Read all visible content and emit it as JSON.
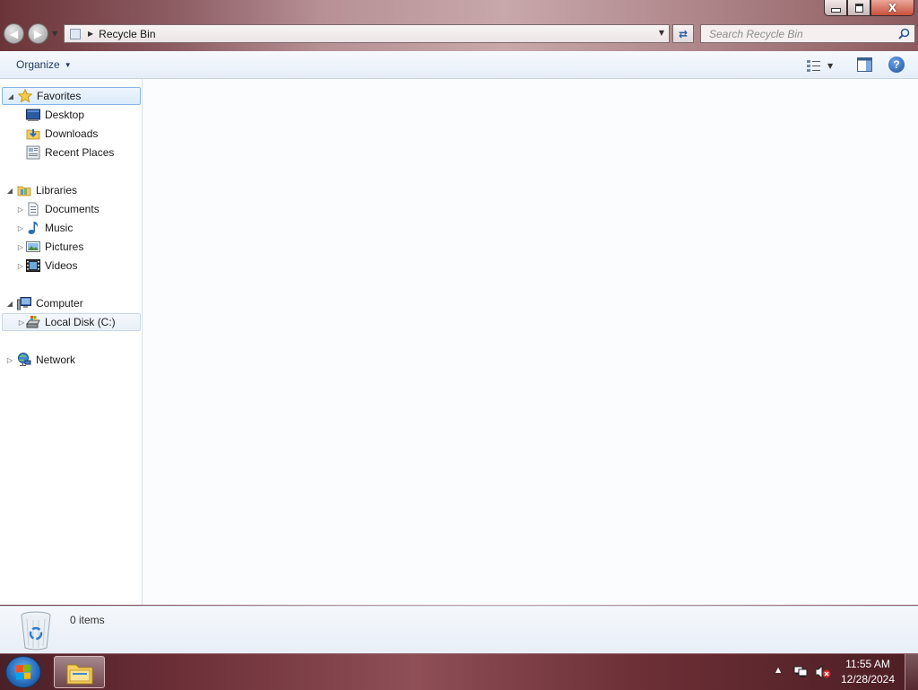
{
  "window": {
    "caption": {
      "minimize": "",
      "maximize": "",
      "close": "X"
    }
  },
  "nav": {
    "breadcrumb": "Recycle Bin",
    "search_placeholder": "Search Recycle Bin"
  },
  "toolbar": {
    "organize_label": "Organize",
    "help_label": "?"
  },
  "sidebar": {
    "favorites": {
      "label": "Favorites",
      "items": [
        {
          "label": "Desktop"
        },
        {
          "label": "Downloads"
        },
        {
          "label": "Recent Places"
        }
      ]
    },
    "libraries": {
      "label": "Libraries",
      "items": [
        {
          "label": "Documents"
        },
        {
          "label": "Music"
        },
        {
          "label": "Pictures"
        },
        {
          "label": "Videos"
        }
      ]
    },
    "computer": {
      "label": "Computer",
      "items": [
        {
          "label": "Local Disk (C:)"
        }
      ]
    },
    "network": {
      "label": "Network"
    }
  },
  "details": {
    "item_count": "0 items"
  },
  "taskbar": {
    "time": "11:55 AM",
    "date": "12/28/2024"
  },
  "colors": {
    "selection_border": "#86b4e8",
    "toolbar_text": "#1e395b",
    "taskbar_base": "#6d2f38"
  }
}
